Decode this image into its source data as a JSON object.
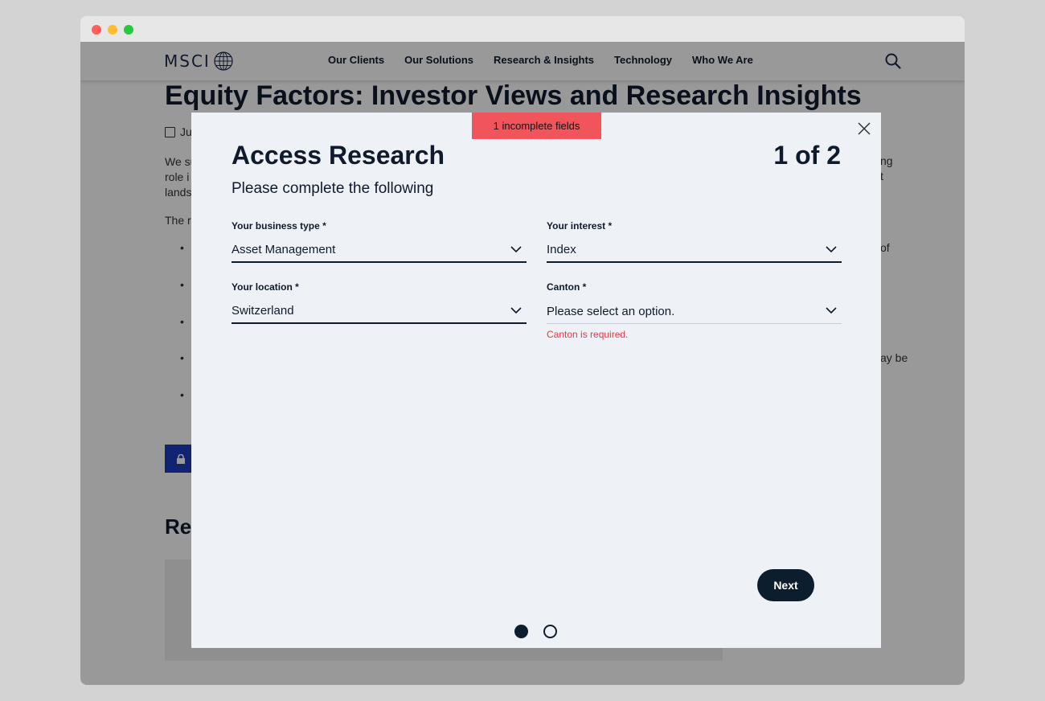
{
  "site": {
    "logo_text": "MSCI",
    "nav": [
      "Our Clients",
      "Our Solutions",
      "Research & Insights",
      "Technology",
      "Who We Are"
    ]
  },
  "page": {
    "title": "Equity Factors: Investor Views and Research Insights",
    "date_fragment": "Ju",
    "intro_fragment_1": "We su",
    "intro_fragment_2": "role i",
    "intro_fragment_3": "lands",
    "intro_fragment_right_1": "ng",
    "intro_fragment_right_2": "t",
    "paragraph_fragment": "The re",
    "bullet_right_fragment_1": "of",
    "bullet_right_fragment_2": "ay be",
    "related_heading_fragment": "Re"
  },
  "modal": {
    "alert": "1 incomplete fields",
    "title": "Access Research",
    "step": "1 of 2",
    "subtitle": "Please complete the following",
    "fields": [
      {
        "label": "Your business type",
        "required_mark": "*",
        "value": "Asset Management",
        "error": ""
      },
      {
        "label": "Your interest",
        "required_mark": "*",
        "value": "Index",
        "error": ""
      },
      {
        "label": "Your location",
        "required_mark": "*",
        "value": "Switzerland",
        "error": ""
      },
      {
        "label": "Canton",
        "required_mark": "*",
        "value": "Please select an option.",
        "error": "Canton is required."
      }
    ],
    "next_label": "Next",
    "pagination": {
      "current": 1,
      "total": 2
    }
  },
  "colors": {
    "alert_bg": "#f2545b",
    "error_text": "#e5384a",
    "primary_dark": "#0c1e2e",
    "modal_bg": "#eef1f6",
    "locked_button": "#1d3bbd"
  }
}
